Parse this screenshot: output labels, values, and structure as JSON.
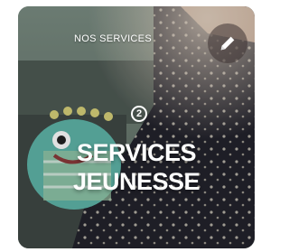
{
  "card": {
    "label": "NOS SERVICES",
    "number": "2",
    "title_line1": "SERVICES",
    "title_line2": "JEUNESSE",
    "edit_icon": "pencil-icon"
  },
  "colors": {
    "text": "#ffffff",
    "edit_button_bg": "#3c3232",
    "teal_plush": "#5fb5a9"
  }
}
